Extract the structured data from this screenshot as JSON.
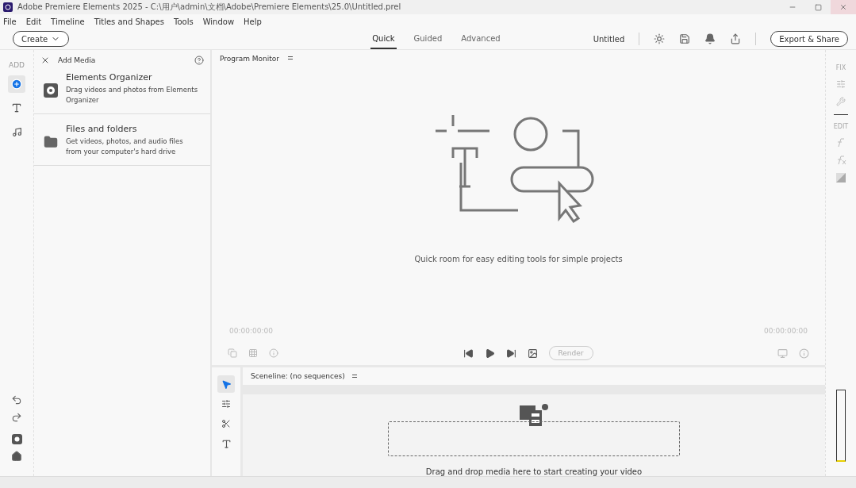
{
  "window": {
    "title": "Adobe Premiere Elements 2025 - C:\\用户\\admin\\文档\\Adobe\\Premiere Elements\\25.0\\Untitled.prel"
  },
  "menu": [
    "File",
    "Edit",
    "Timeline",
    "Titles and Shapes",
    "Tools",
    "Window",
    "Help"
  ],
  "toolbar": {
    "create": "Create",
    "project": "Untitled",
    "export": "Export & Share"
  },
  "modes": [
    {
      "label": "Quick",
      "selected": true
    },
    {
      "label": "Guided",
      "selected": false
    },
    {
      "label": "Advanced",
      "selected": false
    }
  ],
  "left_rail": {
    "label": "ADD",
    "tools": [
      {
        "kind": "add",
        "selected": true
      },
      {
        "kind": "titles",
        "selected": false
      },
      {
        "kind": "music",
        "selected": false
      }
    ]
  },
  "add_media": {
    "title": "Add Media",
    "sources": [
      {
        "kind": "organizer",
        "title": "Elements Organizer",
        "description": "Drag videos and photos from Elements Organizer"
      },
      {
        "kind": "folder",
        "title": "Files and folders",
        "description": "Get videos, photos, and audio files from your computer's hard drive"
      }
    ]
  },
  "monitor": {
    "title": "Program Monitor",
    "message": "Quick room for easy editing tools for simple projects",
    "time_left": "00:00:00:00",
    "time_right": "00:00:00:00",
    "render": "Render"
  },
  "timeline": {
    "title": "Sceneline: (no sequences)",
    "message": "Drag and drop media here to start creating your video",
    "tools": [
      {
        "kind": "select",
        "selected": true
      },
      {
        "kind": "split",
        "selected": false
      },
      {
        "kind": "cut",
        "selected": false
      },
      {
        "kind": "text",
        "selected": false
      }
    ]
  },
  "right_rail": {
    "fix": "FIX",
    "edit": "EDIT"
  }
}
